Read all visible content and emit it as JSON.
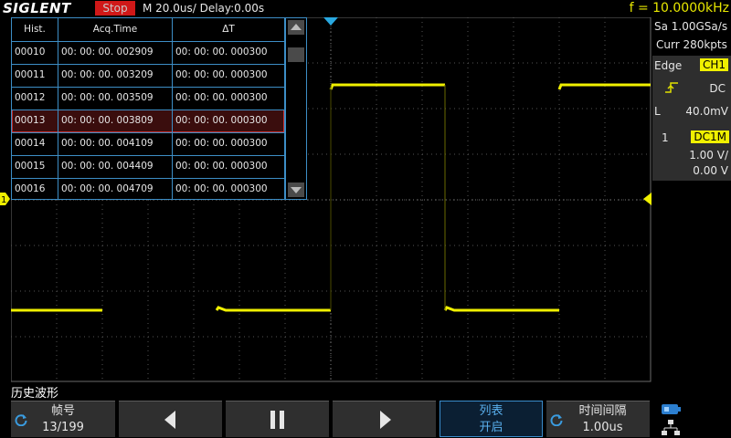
{
  "topbar": {
    "logo": "SIGLENT",
    "run_state": "Stop",
    "timebase": "M 20.0us/  Delay:0.00s",
    "frequency": "f = 10.0000kHz"
  },
  "history_table": {
    "headers": [
      "Hist.",
      "Acq.Time",
      "ΔT"
    ],
    "selected_index": 3,
    "rows": [
      [
        "00010",
        "00: 00: 00. 002909",
        "00: 00: 00. 000300"
      ],
      [
        "00011",
        "00: 00: 00. 003209",
        "00: 00: 00. 000300"
      ],
      [
        "00012",
        "00: 00: 00. 003509",
        "00: 00: 00. 000300"
      ],
      [
        "00013",
        "00: 00: 00. 003809",
        "00: 00: 00. 000300"
      ],
      [
        "00014",
        "00: 00: 00. 004109",
        "00: 00: 00. 000300"
      ],
      [
        "00015",
        "00: 00: 00. 004409",
        "00: 00: 00. 000300"
      ],
      [
        "00016",
        "00: 00: 00. 004709",
        "00: 00: 00. 000300"
      ]
    ]
  },
  "acquisition": {
    "sample_rate": "Sa 1.00GSa/s",
    "memory": "Curr 280kpts"
  },
  "trigger": {
    "type": "Edge",
    "source": "CH1",
    "coupling": "DC",
    "level_prefix": "L",
    "level": "40.0mV"
  },
  "channel": {
    "number": "1",
    "coupling": "DC1M",
    "scale": "1.00 V/",
    "offset": "0.00 V"
  },
  "colors": {
    "trace": "#f0f000",
    "run_state_bg": "#d01818",
    "accent": "#3d8ec6"
  },
  "bottom": {
    "mode_title": "历史波形",
    "frame_label": "帧号",
    "frame_value": "13/199",
    "list_label": "列表",
    "list_value": "开启",
    "interval_label": "时间间隔",
    "interval_value": "1.00us",
    "icons": [
      "knob-icon",
      "prev-icon",
      "pause-icon",
      "next-icon",
      "knob-icon",
      "usb-icon",
      "network-icon"
    ]
  }
}
